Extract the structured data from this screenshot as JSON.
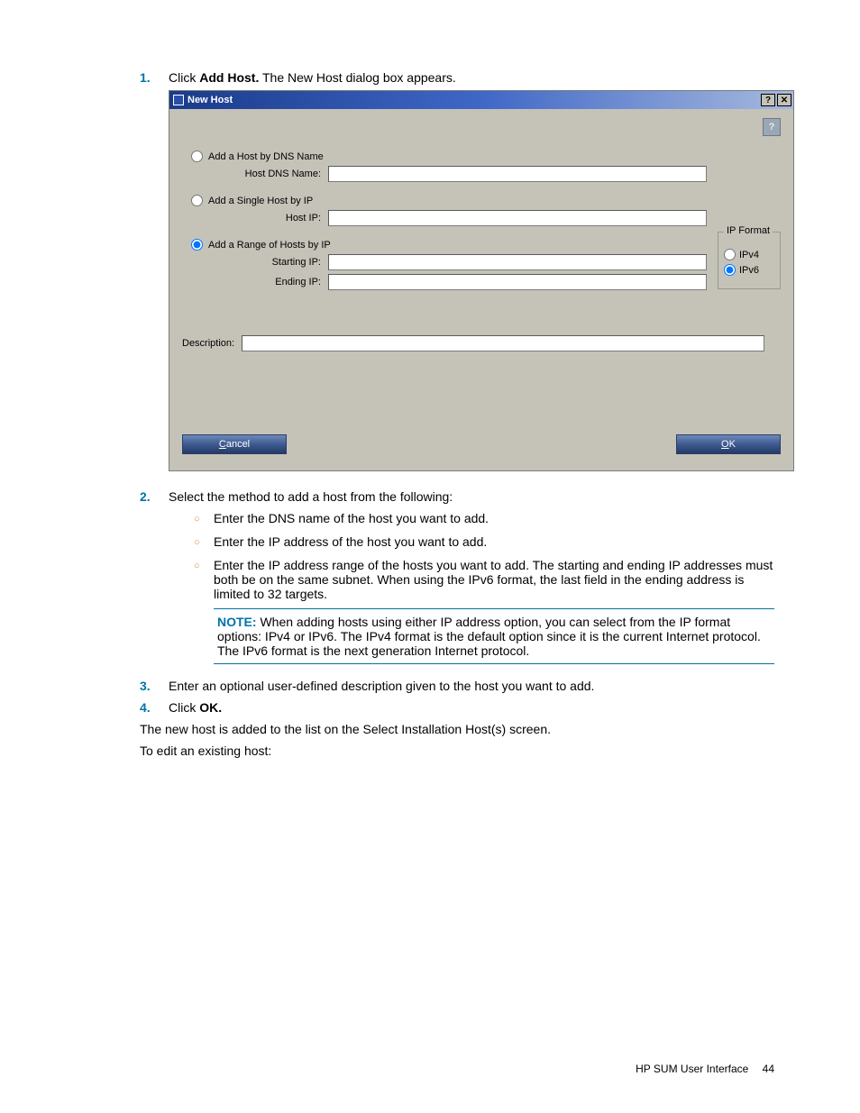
{
  "steps": {
    "s1": {
      "num": "1.",
      "prefix": "Click ",
      "bold": "Add Host.",
      "suffix": " The New Host dialog box appears."
    },
    "s2": {
      "num": "2.",
      "text": "Select the method to add a host from the following:"
    },
    "s2a": "Enter the DNS name of the host you want to add.",
    "s2b": "Enter the IP address of the host you want to add.",
    "s2c": "Enter the IP address range of the hosts you want to add. The starting and ending IP addresses must both be on the same subnet. When using the IPv6 format, the last field in the ending address is limited to 32 targets.",
    "s3": {
      "num": "3.",
      "text": "Enter an optional user-defined description given to the host you want to add."
    },
    "s4": {
      "num": "4.",
      "prefix": "Click ",
      "bold": "OK."
    }
  },
  "note": {
    "label": "NOTE:",
    "text": "  When adding hosts using either IP address option, you can select from the IP format options: IPv4 or IPv6. The IPv4 format is the default option since it is the current Internet protocol. The IPv6 format is the next generation Internet protocol."
  },
  "para1": "The new host is added to the list on the Select Installation Host(s) screen.",
  "para2": "To edit an existing host:",
  "dialog": {
    "title": "New Host",
    "help_btn": "?",
    "close_btn": "✕",
    "corner_help": "?",
    "radio_dns": "Add a Host by DNS Name",
    "label_dns": "Host DNS Name:",
    "radio_single": "Add a Single Host by IP",
    "label_hostip": "Host IP:",
    "radio_range": "Add a Range of Hosts by IP",
    "label_startip": "Starting IP:",
    "label_endip": "Ending IP:",
    "ipformat_legend": "IP Format",
    "ipv4": "IPv4",
    "ipv6": "IPv6",
    "desc_label": "Description:",
    "cancel_u": "C",
    "cancel_rest": "ancel",
    "ok_u": "O",
    "ok_rest": "K"
  },
  "footer": {
    "text": "HP SUM User Interface",
    "page": "44"
  }
}
